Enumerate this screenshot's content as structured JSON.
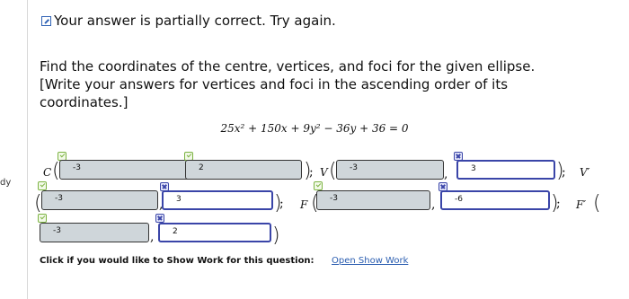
{
  "side_fragment": "dy",
  "status": {
    "message": "Your answer is partially correct.  Try again.",
    "icon": "checkbox-edit-icon"
  },
  "question": {
    "line1": "Find the coordinates of the centre, vertices, and foci for the given ellipse.",
    "line2": "[Write your answers for vertices and foci in the ascending order of its",
    "line3": "coordinates.]"
  },
  "equation": "25x² + 150x + 9y² − 36y + 36 = 0",
  "labels": {
    "centre": "C",
    "vertex1": "V",
    "vertex2": "V′",
    "focus1": "F",
    "focus2": "F′"
  },
  "answers": {
    "centre_x": "-3",
    "centre_y": "2",
    "vertex1_x": "-3",
    "vertex1_y": "3",
    "vertex2_x": "-3",
    "vertex2_y": "3",
    "focus1_x": "-3",
    "focus1_y": "-6",
    "focus2_x": "-3",
    "focus2_y": "2"
  },
  "footer": {
    "prompt": "Click if you would like to Show Work for this question:",
    "link": "Open Show Work"
  },
  "colors": {
    "wrong_fill": "#cfd6da",
    "correct_border": "#3a45a8",
    "correct_mark": "#7cb342",
    "link": "#2a5db0"
  }
}
